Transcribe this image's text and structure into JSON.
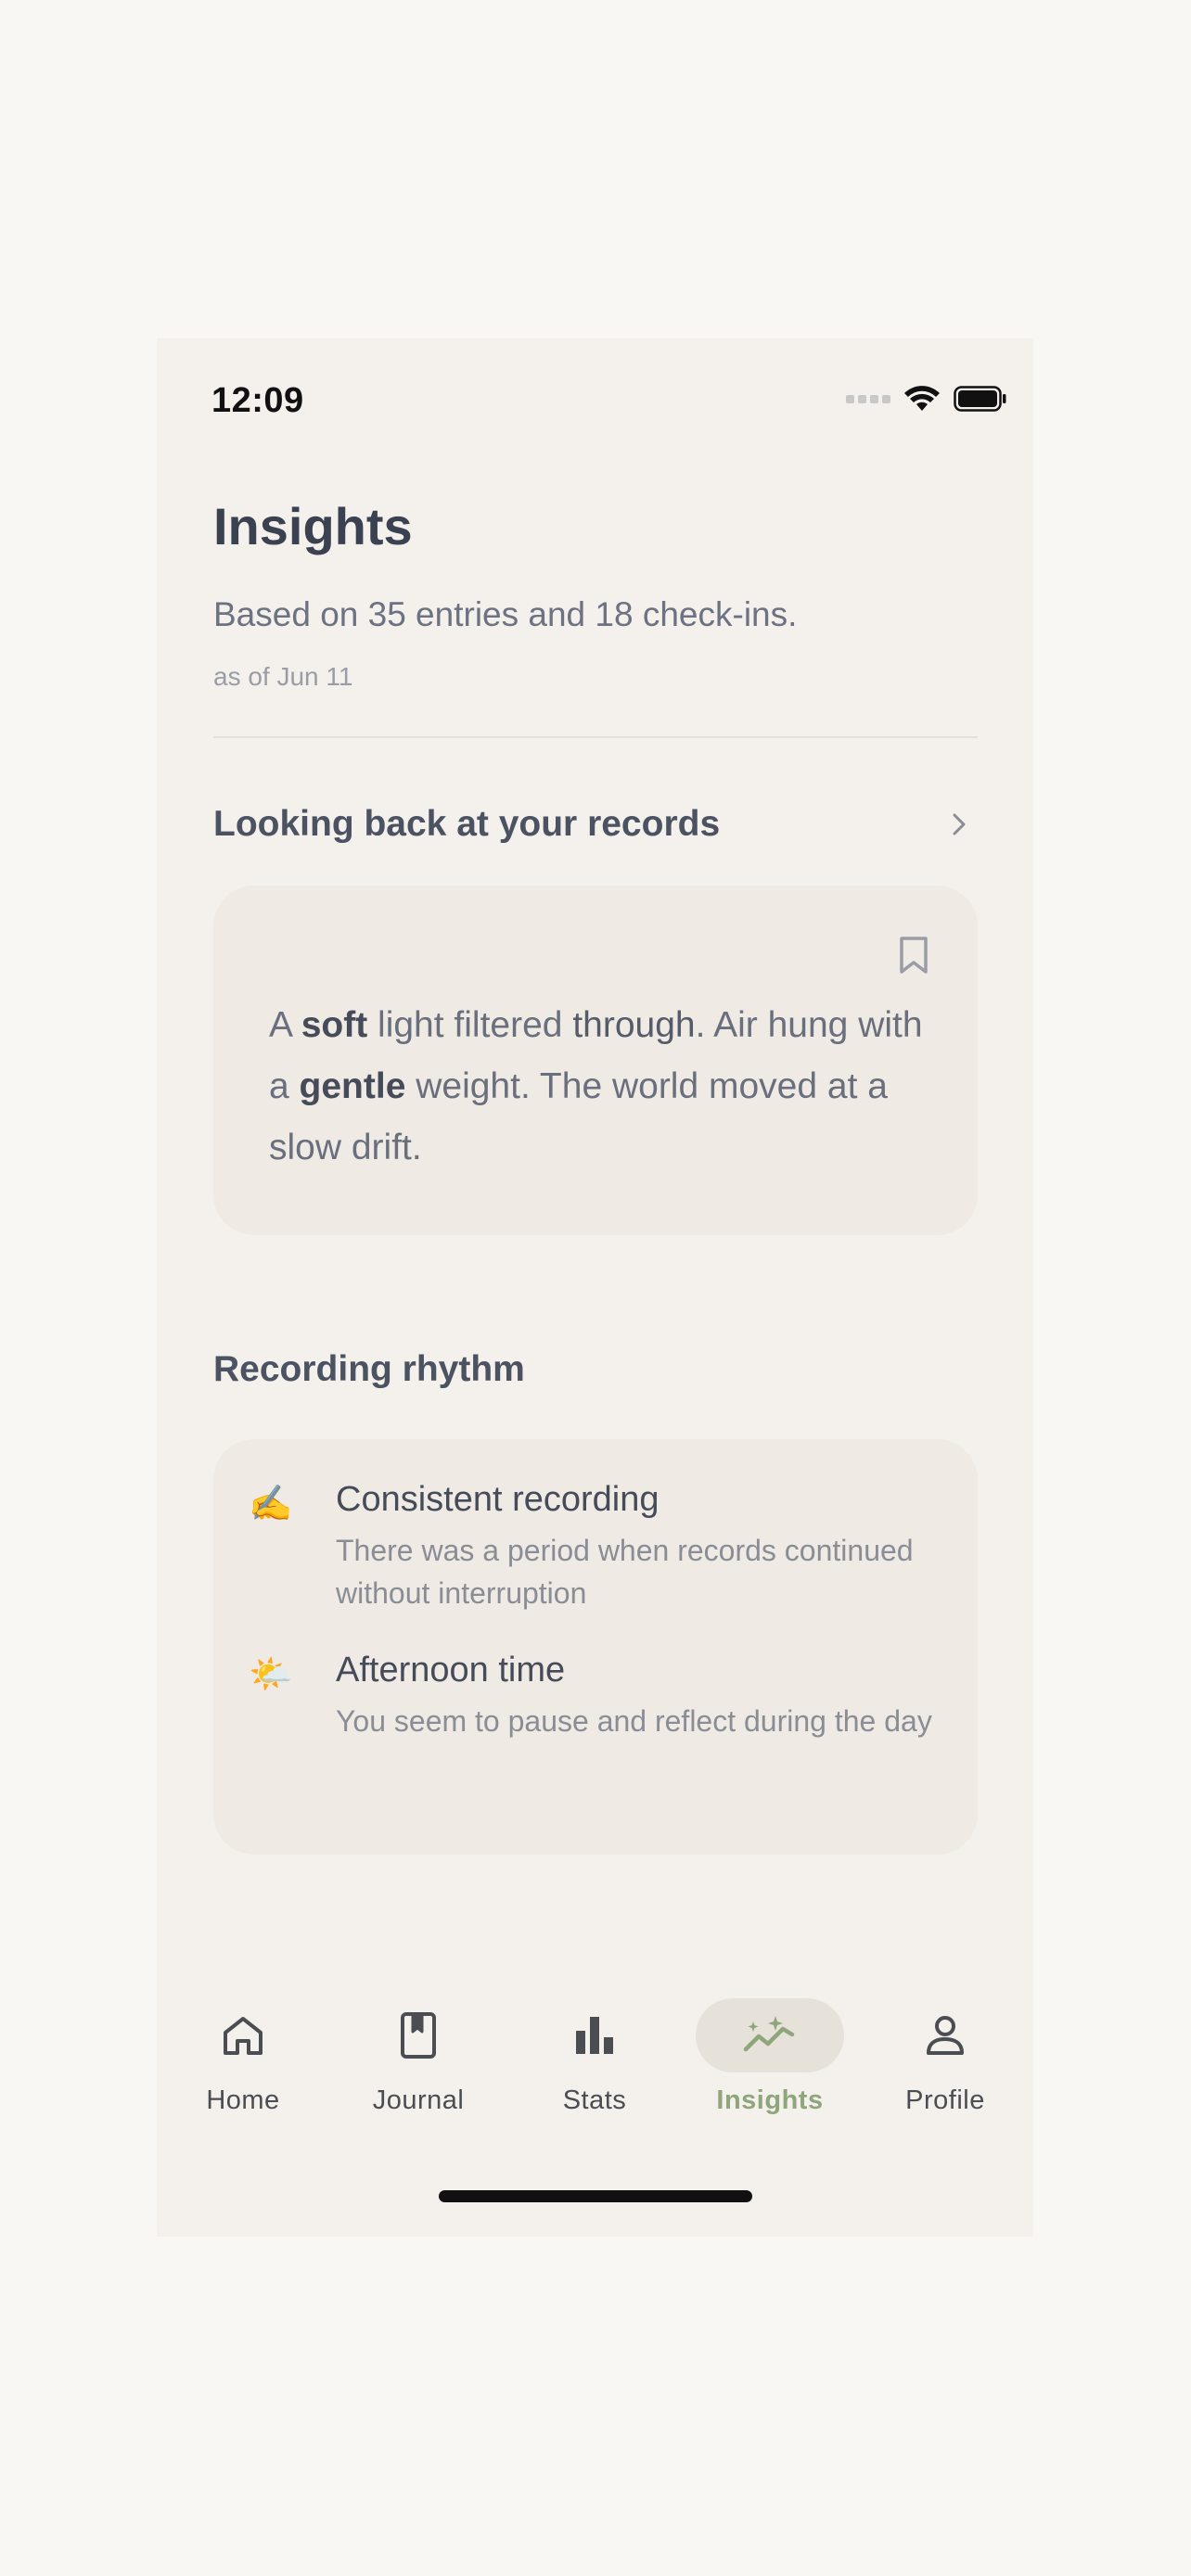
{
  "status_bar": {
    "time": "12:09"
  },
  "header": {
    "title": "Insights",
    "subtitle": "Based on 35 entries and 18 check-ins.",
    "as_of": "as of Jun 11"
  },
  "looking_back": {
    "title": "Looking back at your records",
    "quote": {
      "w1": "A ",
      "b1": "soft",
      "w2": " light filtered ",
      "w3": "through",
      "w4": ". Air hung with a ",
      "b2": "gentle",
      "w5": " weight. The world moved at a slow drift."
    }
  },
  "rhythm": {
    "title": "Recording rhythm",
    "items": [
      {
        "emoji": "✍️",
        "heading": "Consistent recording",
        "description": "There was a period when records continued without interruption"
      },
      {
        "emoji": "🌤️",
        "heading": "Afternoon time",
        "description": "You seem to pause and reflect during the day"
      }
    ]
  },
  "tabbar": {
    "active": "Insights",
    "accent_color": "#8fa67c",
    "tabs": [
      {
        "label": "Home",
        "icon": "home-icon"
      },
      {
        "label": "Journal",
        "icon": "journal-icon"
      },
      {
        "label": "Stats",
        "icon": "stats-icon"
      },
      {
        "label": "Insights",
        "icon": "insights-icon"
      },
      {
        "label": "Profile",
        "icon": "profile-icon"
      }
    ]
  }
}
